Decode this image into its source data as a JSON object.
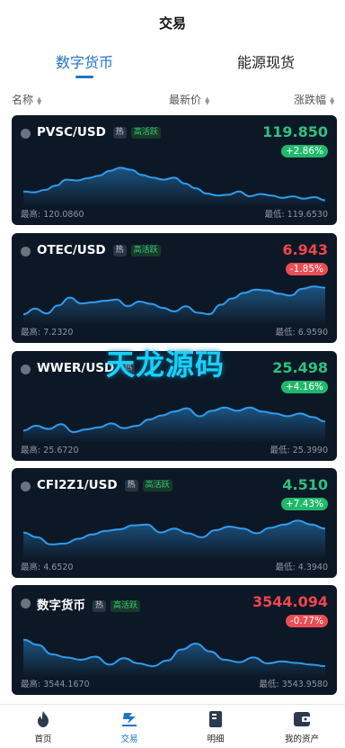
{
  "header": {
    "title": "交易"
  },
  "tabs": [
    {
      "label": "数字货币",
      "active": true
    },
    {
      "label": "能源现货",
      "active": false
    }
  ],
  "columns": {
    "name": "名称",
    "price": "最新价",
    "change": "涨跌幅"
  },
  "colors": {
    "up": "#2ec27e",
    "down": "#f0454e",
    "accent": "#1e74c8",
    "card_bg": "#0d1826",
    "line": "#2f9cf0"
  },
  "cards": [
    {
      "pair": "PVSC/USD",
      "hot": "热",
      "active_tag": "高活跃",
      "price": "119.850",
      "change": "+2.86%",
      "direction": "up",
      "high": "最高: 120.0860",
      "low": "最低: 119.6530",
      "trend": [
        0.7,
        0.72,
        0.66,
        0.55,
        0.4,
        0.42,
        0.36,
        0.3,
        0.18,
        0.1,
        0.15,
        0.28,
        0.35,
        0.4,
        0.35,
        0.5,
        0.62,
        0.75,
        0.8,
        0.78,
        0.7,
        0.82,
        0.76,
        0.8,
        0.86,
        0.82,
        0.88,
        0.84,
        0.92
      ]
    },
    {
      "pair": "OTEC/USD",
      "hot": "热",
      "active_tag": "高活跃",
      "price": "6.943",
      "change": "-1.85%",
      "direction": "down",
      "high": "最高: 7.2320",
      "low": "最低: 6.9590",
      "trend": [
        0.82,
        0.68,
        0.8,
        0.6,
        0.4,
        0.55,
        0.52,
        0.48,
        0.45,
        0.62,
        0.5,
        0.56,
        0.66,
        0.75,
        0.62,
        0.78,
        0.82,
        0.58,
        0.42,
        0.28,
        0.2,
        0.22,
        0.3,
        0.35,
        0.18,
        0.12,
        0.15
      ]
    },
    {
      "pair": "WWER/USD",
      "hot": "热",
      "active_tag": "",
      "price": "25.498",
      "change": "+4.16%",
      "direction": "up",
      "high": "最高: 25.6720",
      "low": "最低: 25.3990",
      "trend": [
        0.78,
        0.66,
        0.74,
        0.62,
        0.82,
        0.75,
        0.7,
        0.6,
        0.72,
        0.66,
        0.5,
        0.4,
        0.3,
        0.22,
        0.42,
        0.28,
        0.2,
        0.28,
        0.2,
        0.3,
        0.35,
        0.42,
        0.35,
        0.44,
        0.55
      ]
    },
    {
      "pair": "CFI2Z1/USD",
      "hot": "热",
      "active_tag": "高活跃",
      "price": "4.510",
      "change": "+7.43%",
      "direction": "up",
      "high": "最高: 4.6520",
      "low": "最低: 4.3940",
      "trend": [
        0.4,
        0.52,
        0.7,
        0.68,
        0.56,
        0.45,
        0.36,
        0.32,
        0.22,
        0.2,
        0.4,
        0.3,
        0.42,
        0.52,
        0.34,
        0.25,
        0.3,
        0.42,
        0.28,
        0.2,
        0.1,
        0.2,
        0.3
      ]
    },
    {
      "pair": "数字货币",
      "hot": "热",
      "active_tag": "高活跃",
      "price": "3544.094",
      "change": "-0.77%",
      "direction": "down",
      "high": "最高: 3544.1670",
      "low": "最低: 3543.9580",
      "trend": [
        0.15,
        0.28,
        0.52,
        0.6,
        0.66,
        0.58,
        0.78,
        0.62,
        0.75,
        0.82,
        0.68,
        0.4,
        0.25,
        0.45,
        0.66,
        0.72,
        0.6,
        0.75,
        0.7,
        0.74,
        0.78,
        0.82
      ]
    }
  ],
  "watermark": "天龙源码",
  "tabbar": [
    {
      "label": "首页",
      "icon": "flame-icon",
      "active": false
    },
    {
      "label": "交易",
      "icon": "trade-icon",
      "active": true
    },
    {
      "label": "明细",
      "icon": "book-icon",
      "active": false
    },
    {
      "label": "我的资产",
      "icon": "wallet-icon",
      "active": false
    }
  ]
}
